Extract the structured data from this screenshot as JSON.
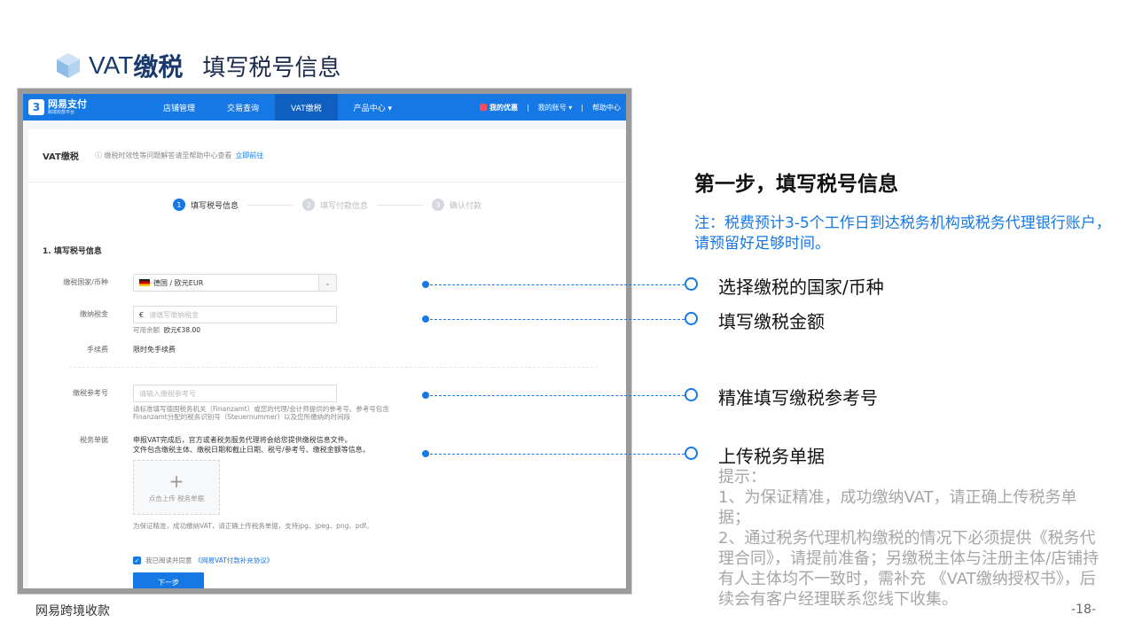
{
  "header": {
    "title_prefix": "VAT",
    "title_bold": "缴税",
    "subtitle": "填写税号信息"
  },
  "app": {
    "logo": {
      "name": "网易支付",
      "tagline": "跨境收款平台"
    },
    "nav": {
      "items": [
        "店铺管理",
        "交易查询",
        "VAT缴税",
        "产品中心 ▾"
      ],
      "right": [
        "我的优惠",
        "|",
        "我的账号 ▾",
        "|",
        "帮助中心"
      ]
    },
    "page_title": "VAT缴税",
    "help_tip": "缴税时效性等问题解答请至帮助中心查看",
    "help_link": "立即前往",
    "steps": [
      {
        "num": "1",
        "label": "填写税号信息"
      },
      {
        "num": "2",
        "label": "填写付款信息"
      },
      {
        "num": "3",
        "label": "确认付款"
      }
    ],
    "section_title": "1. 填写税号信息",
    "form": {
      "country_label": "缴税国家/币种",
      "country_value": "德国 / 欧元EUR",
      "amount_label": "缴纳税金",
      "amount_prefix": "€",
      "amount_placeholder": "请填写缴纳税金",
      "balance_label": "可用余额",
      "balance_value": "欧元€38.00",
      "fee_label": "手续费",
      "fee_value": "限时免手续费",
      "ref_label": "缴税参考号",
      "ref_placeholder": "请输入缴税参考号",
      "ref_note": "请标准填写德国税务机关（Finanzamt）或您的代理/会计师提供的参考号。参考号包含Finanzamt分配的税务识别号（Steuernummer）以及您所缴纳的时间段",
      "doc_label": "税务单据",
      "doc_note1": "申报VAT完成后，官方或者税务服务代理将会给您提供缴税信息文件。",
      "doc_note2": "文件包含缴税主体、缴税日期和截止日期、税号/参考号、缴税金额等信息。",
      "upload_text": "点击上传 税务单据",
      "upload_hint": "为保证精准，成功缴纳VAT，请正确上传税务单据，支持jpg、jpeg、png、pdf。",
      "agree_text": "我已阅读并同意",
      "agree_link": "《网易VAT付款补充协议》",
      "next_button": "下一步"
    }
  },
  "right": {
    "title": "第一步，填写税号信息",
    "note": "注：税费预计3-5个工作日到达税务机构或税务代理银行账户，请预留好足够时间。",
    "callouts": [
      "选择缴税的国家/币种",
      "填写缴税金额",
      "精准填写缴税参考号",
      "上传税务单据"
    ],
    "tips": [
      "提示：",
      "1、为保证精准，成功缴纳VAT，请正确上传税务单据；",
      "2、通过税务代理机构缴税的情况下必须提供《税务代理合同》，请提前准备；另缴税主体与注册主体/店铺持有人主体均不一致时，需补充 《VAT缴纳授权书》，后续会有客户经理联系您线下收集。"
    ]
  },
  "footer": {
    "brand": "网易跨境收款",
    "page": "-18-"
  }
}
